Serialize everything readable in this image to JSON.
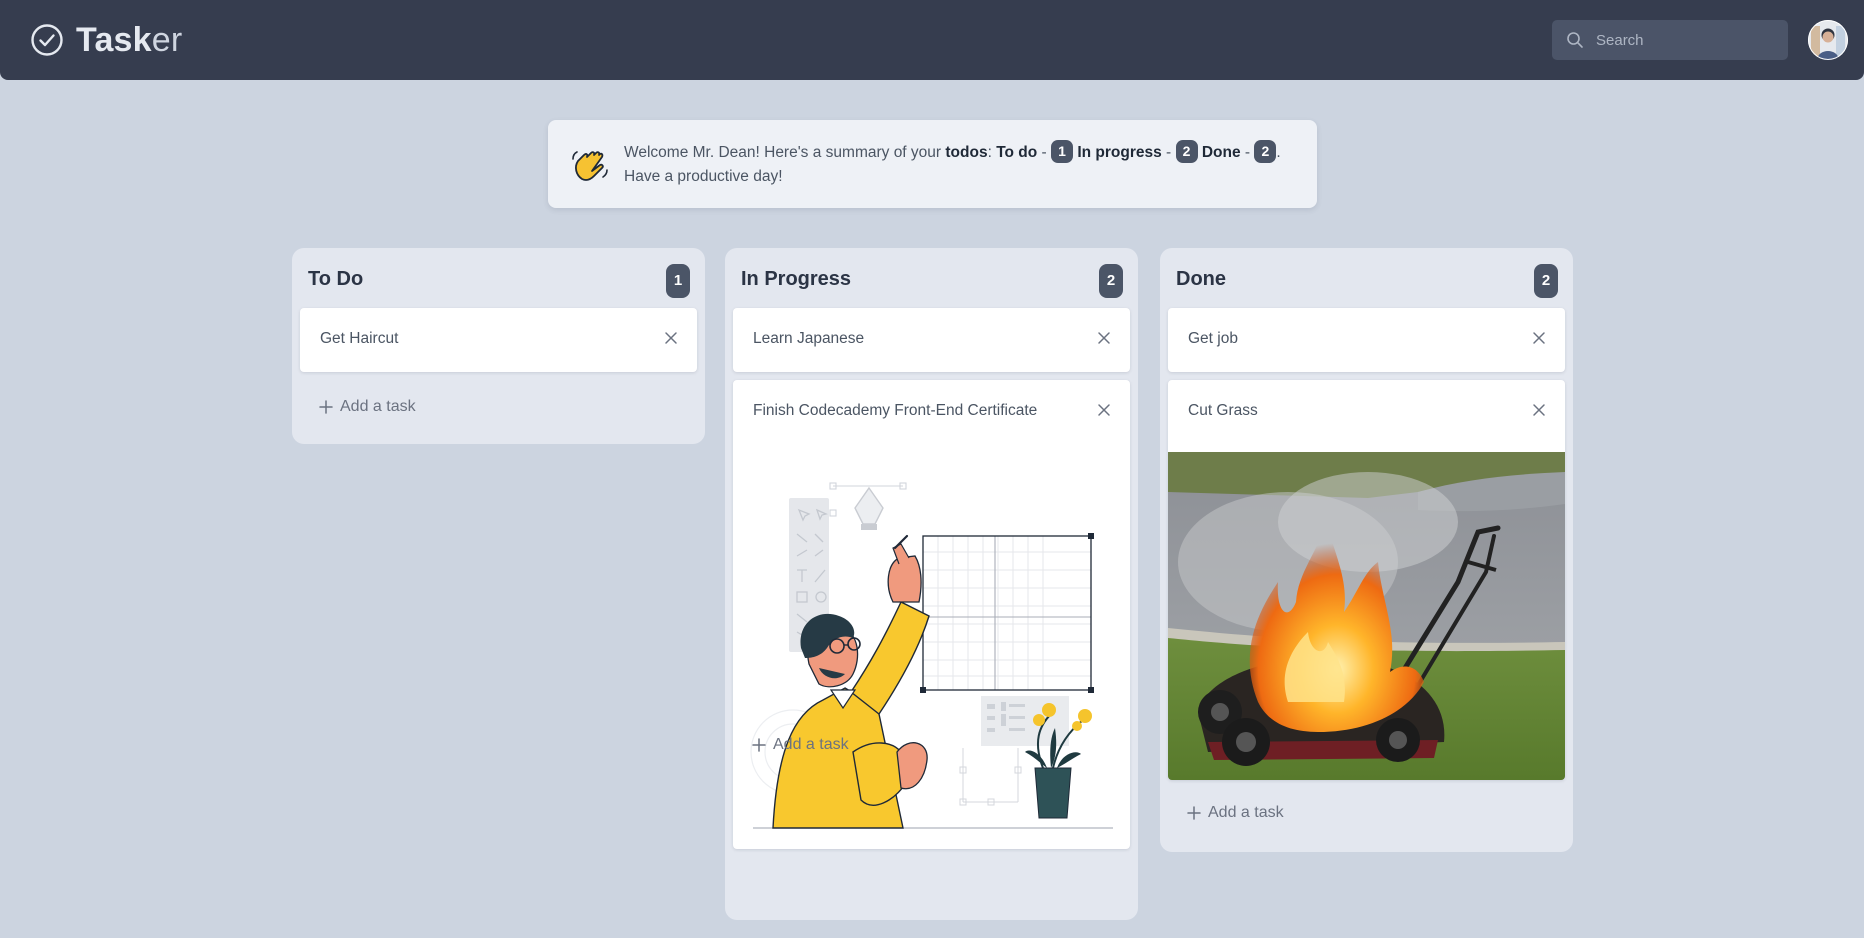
{
  "brand": {
    "name_strong": "Task",
    "name_light": "er",
    "icon": "check-circle-icon"
  },
  "search": {
    "placeholder": "Search",
    "value": "",
    "icon": "search-icon"
  },
  "user": {
    "avatar": "user-avatar"
  },
  "welcome": {
    "icon": "waving-hand-icon",
    "greeting": "Welcome Mr. Dean! Here's a summary of your ",
    "todos_label": "todos",
    "todo_label": "To do",
    "todo_count": "1",
    "in_progress_label": "In progress",
    "in_progress_count": "2",
    "done_label": "Done",
    "done_count": "2",
    "closing": "Have a productive day!"
  },
  "columns": [
    {
      "title": "To Do",
      "count": "1",
      "cards": [
        {
          "title": "Get Haircut"
        }
      ],
      "add_label": "Add a task"
    },
    {
      "title": "In Progress",
      "count": "2",
      "cards": [
        {
          "title": "Learn Japanese"
        },
        {
          "title": "Finish Codecademy Front-End Certificate",
          "image": "designer-illustration"
        }
      ],
      "add_label": "Add a task"
    },
    {
      "title": "Done",
      "count": "2",
      "cards": [
        {
          "title": "Get job"
        },
        {
          "title": "Cut Grass",
          "image": "burning-lawn-mower-photo"
        }
      ],
      "add_label": "Add a task"
    }
  ],
  "colors": {
    "header": "#363d4f",
    "background": "#ccd4e0",
    "column": "#e3e7ef",
    "badge": "#4b5567",
    "accent_yellow": "#f5c42c"
  }
}
